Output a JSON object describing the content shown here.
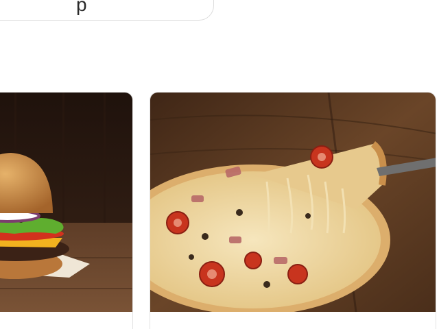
{
  "search": {
    "visible_text": "p"
  },
  "cards": [
    {
      "image_subject": "burger-photo",
      "colors": {
        "background": "#2b1a12",
        "table": "#6a452c",
        "bun": "#c98a43"
      }
    },
    {
      "image_subject": "pizza-photo",
      "colors": {
        "background": "#5a3a24",
        "crust": "#e0b679",
        "cheese": "#f2ddb0",
        "tomato": "#c8341e"
      }
    }
  ]
}
